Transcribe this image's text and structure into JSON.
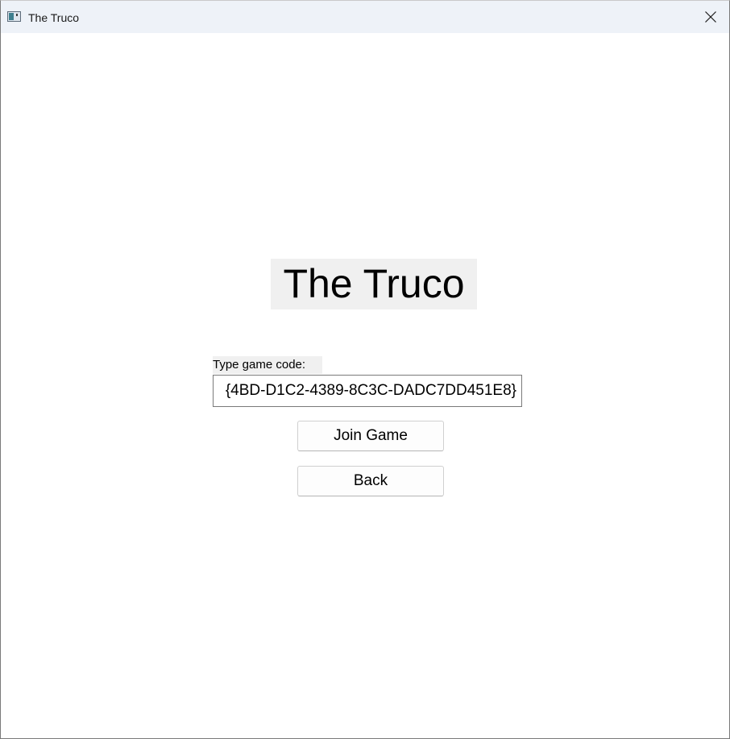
{
  "window": {
    "title": "The Truco",
    "icon": "app-window-icon",
    "close_icon": "close-icon"
  },
  "main": {
    "heading": "The Truco",
    "code_label": "Type game code:",
    "code_value": "{4BD-D1C2-4389-8C3C-DADC7DD451E8}",
    "join_button": "Join Game",
    "back_button": "Back"
  }
}
